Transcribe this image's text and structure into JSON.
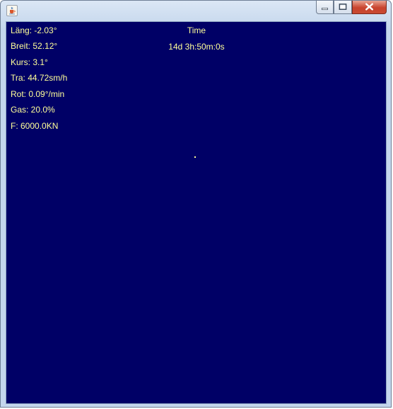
{
  "window": {
    "icon": "java-cup-icon",
    "controls": [
      "minimize-icon",
      "maximize-icon",
      "close-icon"
    ]
  },
  "hud": {
    "laengengrad": "Läng: -2.03°",
    "breitengrad": "Breit: 52.12°",
    "kurs": "Kurs: 3.1°",
    "fahrt": "Tra: 44.72sm/h",
    "rot": "Rot: 0.09°/min",
    "gas": "Gas: 20.0%",
    "kraft": "F: 6000.0KN"
  },
  "time": {
    "label": "Time",
    "value": "14d 3h:50m:0s"
  },
  "colors": {
    "background": "#000066",
    "text": "#ffff99"
  }
}
